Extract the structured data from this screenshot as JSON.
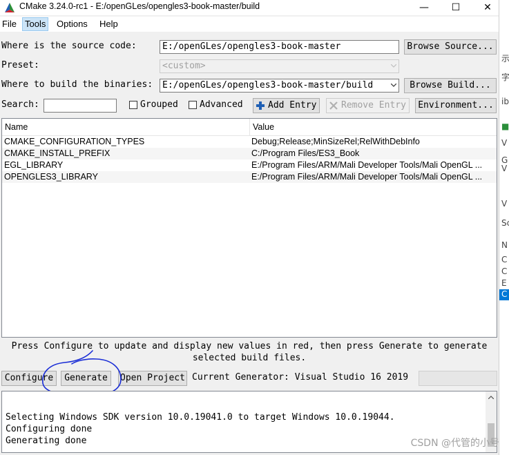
{
  "window": {
    "title": "CMake 3.24.0-rc1 - E:/openGLes/opengles3-book-master/build",
    "controls": {
      "minimize": "—",
      "maximize": "☐",
      "close": "✕"
    }
  },
  "menu": [
    {
      "label": "File"
    },
    {
      "label": "Tools"
    },
    {
      "label": "Options"
    },
    {
      "label": "Help"
    }
  ],
  "source": {
    "label": "Where is the source code:",
    "value": "E:/openGLes/opengles3-book-master",
    "browse_label": "Browse Source..."
  },
  "preset": {
    "label": "Preset:",
    "value": "<custom>"
  },
  "build": {
    "label": "Where to build the binaries:",
    "value": "E:/openGLes/opengles3-book-master/build",
    "browse_label": "Browse Build..."
  },
  "search": {
    "label": "Search:",
    "value": ""
  },
  "options": {
    "grouped_label": "Grouped",
    "advanced_label": "Advanced",
    "grouped_checked": false,
    "advanced_checked": false
  },
  "buttons": {
    "add_entry": "Add Entry",
    "remove_entry": "Remove Entry",
    "environment": "Environment..."
  },
  "table": {
    "columns": [
      "Name",
      "Value"
    ],
    "rows": [
      {
        "name": "CMAKE_CONFIGURATION_TYPES",
        "value": "Debug;Release;MinSizeRel;RelWithDebInfo"
      },
      {
        "name": "CMAKE_INSTALL_PREFIX",
        "value": "C:/Program Files/ES3_Book"
      },
      {
        "name": "EGL_LIBRARY",
        "value": "E:/Program Files/ARM/Mali Developer Tools/Mali OpenGL ..."
      },
      {
        "name": "OPENGLES3_LIBRARY",
        "value": "E:/Program Files/ARM/Mali Developer Tools/Mali OpenGL ..."
      }
    ]
  },
  "message": "Press Configure to update and display new values in red, then press Generate to generate\nselected build files.",
  "actions": {
    "configure": "Configure",
    "generate": "Generate",
    "open_project": "Open Project",
    "generator": "Current Generator: Visual Studio 16 2019"
  },
  "output": "Selecting Windows SDK version 10.0.19041.0 to target Windows 10.0.19044.\nConfiguring done\nGenerating done",
  "side_strip": [
    "示",
    "字",
    "ib",
    "■",
    "V",
    "G",
    "V",
    "V",
    "Sc",
    "N",
    "C",
    "C",
    "E",
    "C"
  ],
  "watermark": "CSDN @代管的小号",
  "colors": {
    "annotation": "#1a2dd6",
    "selection": "#cce4f7",
    "side_highlight": "#0078d7"
  }
}
